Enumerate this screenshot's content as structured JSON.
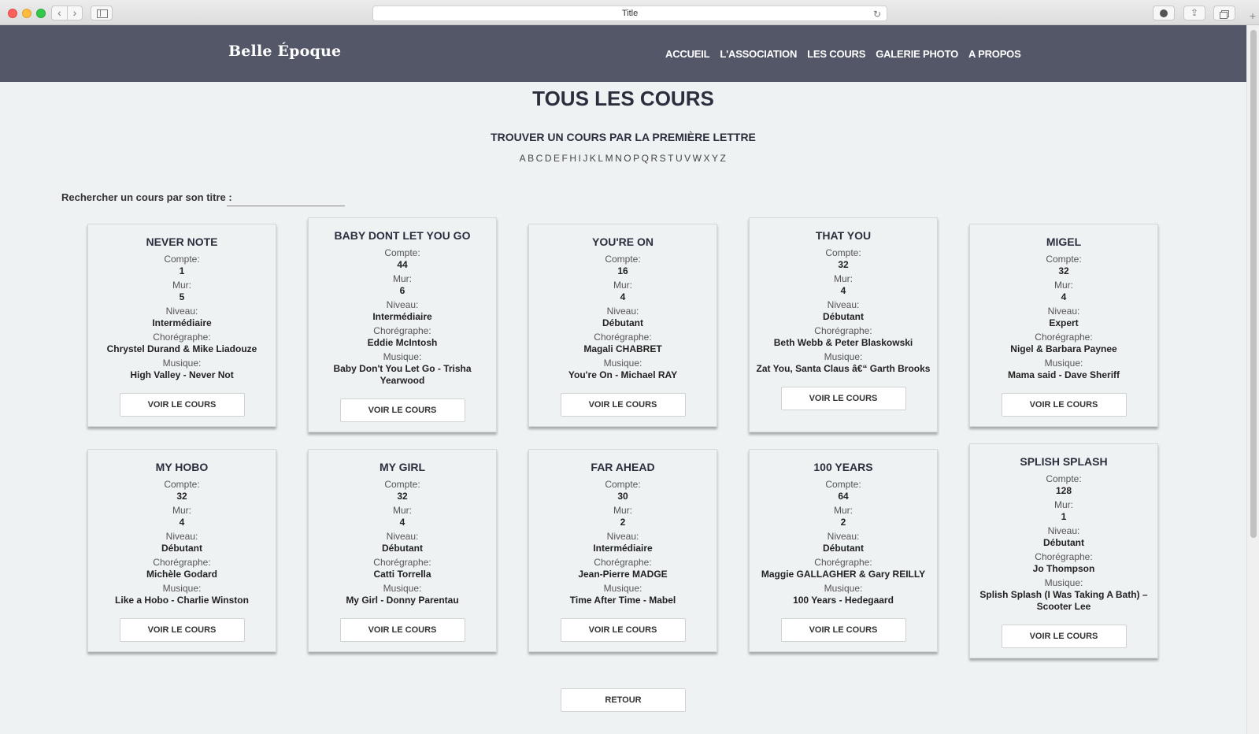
{
  "browser": {
    "title": "Title"
  },
  "site": {
    "logo": "Belle Époque",
    "nav": [
      "ACCUEIL",
      "L'ASSOCIATION",
      "LES COURS",
      "GALERIE PHOTO",
      "A PROPOS"
    ]
  },
  "page": {
    "title": "TOUS LES COURS",
    "letter_title": "TROUVER UN COURS PAR LA PREMIÈRE LETTRE",
    "letters": [
      "A",
      "B",
      "C",
      "D",
      "E",
      "F",
      "H",
      "I",
      "J",
      "K",
      "L",
      "M",
      "N",
      "O",
      "P",
      "Q",
      "R",
      "S",
      "T",
      "U",
      "V",
      "W",
      "X",
      "Y",
      "Z"
    ],
    "search_label": "Rechercher un cours par son titre :",
    "search_value": "",
    "back_label": "RETOUR"
  },
  "labels": {
    "compte": "Compte:",
    "mur": "Mur:",
    "niveau": "Niveau:",
    "choregraphe": "Chorégraphe:",
    "musique": "Musique:",
    "view_button": "VOIR LE COURS"
  },
  "cards": [
    {
      "title": "NEVER NOTE",
      "compte": "1",
      "mur": "5",
      "niveau": "Intermédiaire",
      "choregraphe": "Chrystel Durand & Mike Liadouze",
      "musique": "High Valley - Never Not"
    },
    {
      "title": "BABY DONT LET YOU GO",
      "compte": "44",
      "mur": "6",
      "niveau": "Intermédiaire",
      "choregraphe": "Eddie McIntosh",
      "musique": "Baby Don't You Let Go - Trisha Yearwood"
    },
    {
      "title": "YOU'RE ON",
      "compte": "16",
      "mur": "4",
      "niveau": "Débutant",
      "choregraphe": "Magali CHABRET",
      "musique": "You're On - Michael RAY"
    },
    {
      "title": "THAT YOU",
      "compte": "32",
      "mur": "4",
      "niveau": "Débutant",
      "choregraphe": "Beth Webb & Peter Blaskowski",
      "musique": "Zat You, Santa Claus â€“ Garth Brooks"
    },
    {
      "title": "MIGEL",
      "compte": "32",
      "mur": "4",
      "niveau": "Expert",
      "choregraphe": "Nigel & Barbara Paynee",
      "musique": "Mama said - Dave Sheriff"
    },
    {
      "title": "MY HOBO",
      "compte": "32",
      "mur": "4",
      "niveau": "Débutant",
      "choregraphe": "Michèle Godard",
      "musique": "Like a Hobo - Charlie Winston"
    },
    {
      "title": "MY GIRL",
      "compte": "32",
      "mur": "4",
      "niveau": "Débutant",
      "choregraphe": "Catti Torrella",
      "musique": "My Girl - Donny Parentau"
    },
    {
      "title": "FAR AHEAD",
      "compte": "30",
      "mur": "2",
      "niveau": "Intermédiaire",
      "choregraphe": "Jean-Pierre MADGE",
      "musique": "Time After Time - Mabel"
    },
    {
      "title": "100 YEARS",
      "compte": "64",
      "mur": "2",
      "niveau": "Débutant",
      "choregraphe": "Maggie GALLAGHER & Gary REILLY",
      "musique": "100 Years - Hedegaard"
    },
    {
      "title": "SPLISH SPLASH",
      "compte": "128",
      "mur": "1",
      "niveau": "Débutant",
      "choregraphe": "Jo Thompson",
      "musique": "Splish Splash (I Was Taking A Bath) – Scooter Lee"
    }
  ]
}
